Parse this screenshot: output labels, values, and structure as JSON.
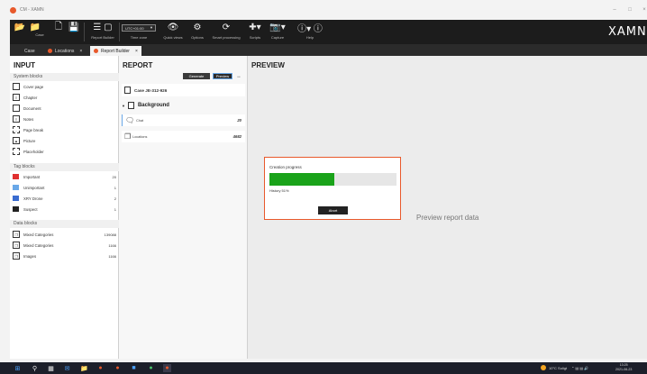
{
  "window": {
    "title": "CM - XAMN"
  },
  "ribbon": {
    "case_label": "Case",
    "report_builder_label": "Report Builder",
    "timezone_value": "UTC+01:00",
    "timezone_label": "Time zone",
    "quick_views_label": "Quick views",
    "options_label": "Options",
    "smart_processing_label": "Smart processing",
    "scripts_label": "Scripts",
    "capture_label": "Capture",
    "help_label": "Help",
    "logo_text": "XAMN"
  },
  "tabs": [
    {
      "label": "Case"
    },
    {
      "label": "Locations"
    },
    {
      "label": "Report Builder"
    }
  ],
  "input": {
    "heading": "INPUT",
    "system_blocks_label": "System blocks",
    "system_blocks": [
      {
        "label": "Cover page"
      },
      {
        "label": "Chapter"
      },
      {
        "label": "Document"
      },
      {
        "label": "Notes"
      },
      {
        "label": "Page break"
      },
      {
        "label": "Picture"
      },
      {
        "label": "Placeholder"
      }
    ],
    "tag_blocks_label": "Tag blocks",
    "tag_blocks": [
      {
        "label": "Important",
        "count": "20",
        "color": "#e03030"
      },
      {
        "label": "Unimportant",
        "count": "1",
        "color": "#6aa8e8"
      },
      {
        "label": "XRY Drone",
        "count": "2",
        "color": "#3a6cd0"
      },
      {
        "label": "Suspect",
        "count": "1",
        "color": "#222222"
      }
    ],
    "data_blocks_label": "Data blocks",
    "data_blocks": [
      {
        "label": "Mixed Categories",
        "count": "139088"
      },
      {
        "label": "Mixed Categories",
        "count": "1166"
      },
      {
        "label": "Images",
        "count": "1166"
      }
    ]
  },
  "report": {
    "heading": "REPORT",
    "generate_label": "Generate",
    "preview_label": "Preview",
    "more_label": "•••",
    "case_title": "Case JE-312-926",
    "section_title": "Background",
    "rows": [
      {
        "label": "Chat",
        "count": "20"
      },
      {
        "label": "Locations",
        "count": "4682"
      }
    ]
  },
  "preview": {
    "heading": "PREVIEW",
    "progress_title": "Creation progress",
    "progress_fraction": 0.51,
    "progress_status": "History 51%",
    "abort_label": "Abort",
    "placeholder_text": "Preview report data"
  },
  "taskbar": {
    "weather": "10°C  Soligt",
    "time": "13:25",
    "date": "2021-06-23"
  }
}
